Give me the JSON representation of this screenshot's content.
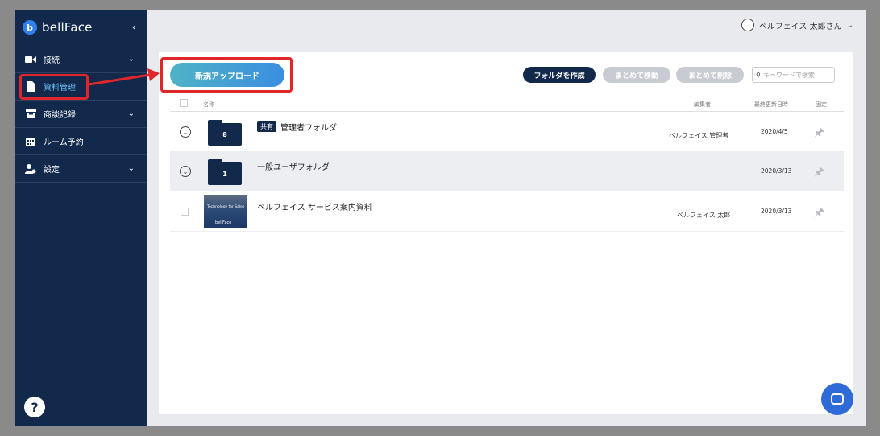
{
  "logo": {
    "mark": "b",
    "text": "bellFace"
  },
  "sidebar": {
    "collapse": "‹",
    "items": [
      {
        "label": "接続",
        "icon": "camera-icon"
      },
      {
        "label": "資料管理",
        "icon": "document-icon"
      },
      {
        "label": "商談記録",
        "icon": "archive-icon"
      },
      {
        "label": "ルーム予約",
        "icon": "calendar-icon"
      },
      {
        "label": "設定",
        "icon": "user-settings-icon"
      }
    ],
    "help": "?"
  },
  "header": {
    "user_name": "ベルフェイス 太郎さん"
  },
  "toolbar": {
    "upload_label": "新規アップロード",
    "create_folder_label": "フォルダを作成",
    "move_label": "まとめて移動",
    "delete_label": "まとめて削除",
    "search_placeholder": "キーワードで検索"
  },
  "table": {
    "headers": {
      "name": "名称",
      "editor": "編集者",
      "updated": "最終更新日時",
      "pinned": "固定"
    },
    "rows": [
      {
        "type": "folder",
        "count": "8",
        "badge": "共有",
        "name": "管理者フォルダ",
        "editor": "ベルフェイス 管理者",
        "date": "2020/4/5"
      },
      {
        "type": "folder",
        "count": "1",
        "badge": "",
        "name": "一般ユーザフォルダ",
        "editor": "",
        "date": "2020/3/13"
      },
      {
        "type": "file",
        "thumb_title": "Technology for Sales",
        "thumb_logo": "bellFace",
        "name": "ベルフェイス サービス案内資料",
        "editor": "ベルフェイス 太郎",
        "date": "2020/3/13"
      }
    ]
  },
  "colors": {
    "sidebar": "#13294b",
    "accent": "#2f80ed",
    "highlight": "#e0262b"
  }
}
